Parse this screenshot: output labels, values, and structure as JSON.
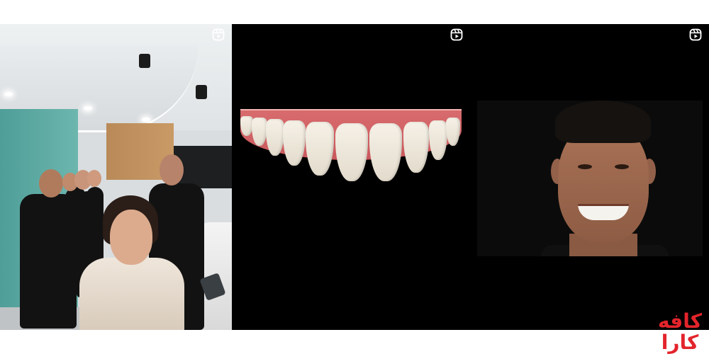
{
  "gallery": {
    "tiles": [
      {
        "icon": "reels-icon"
      },
      {
        "icon": "reels-icon"
      },
      {
        "icon": "reels-icon"
      }
    ]
  },
  "logo": {
    "line1": "کافه",
    "line2": "کارا",
    "color": "#e3242b"
  }
}
